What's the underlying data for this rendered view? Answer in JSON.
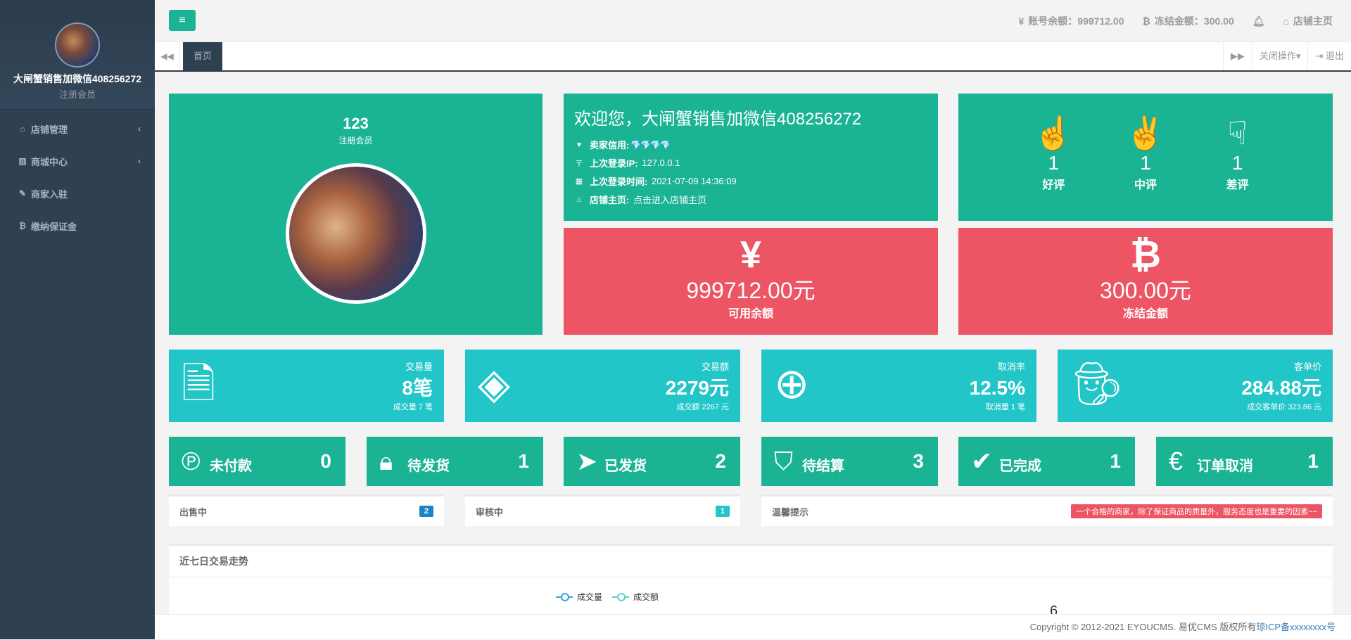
{
  "sidebar": {
    "username": "大闸蟹销售加微信408256272",
    "role": "注册会员",
    "items": [
      {
        "label": "店铺管理",
        "icon": "home-icon"
      },
      {
        "label": "商城中心",
        "icon": "bar-chart-icon"
      },
      {
        "label": "商家入驻",
        "icon": "edit-icon"
      },
      {
        "label": "缴纳保证金",
        "icon": "bitcoin-icon"
      }
    ]
  },
  "topbar": {
    "balance_label": "账号余额：",
    "balance_value": "999712.00",
    "frozen_label": "冻结金额：",
    "frozen_value": "300.00",
    "shop_home": "店铺主页"
  },
  "tabs": {
    "home": "首页",
    "close_ops": "关闭操作",
    "logout": "退出"
  },
  "profile": {
    "number": "123",
    "role": "注册会员"
  },
  "welcome": {
    "title": "欢迎您，大闸蟹销售加微信408256272",
    "credit_label": "卖家信用:",
    "credit_value": "💎💎💎💎",
    "ip_label": "上次登录IP:",
    "ip_value": "127.0.0.1",
    "time_label": "上次登录时间:",
    "time_value": "2021-07-09 14:36:09",
    "home_label": "店铺主页:",
    "home_value": "点击进入店铺主页"
  },
  "ratings": [
    {
      "count": "1",
      "label": "好评"
    },
    {
      "count": "1",
      "label": "中评"
    },
    {
      "count": "1",
      "label": "差评"
    }
  ],
  "money": {
    "available_symbol": "¥",
    "available_value": "999712.00元",
    "available_label": "可用余额",
    "frozen_symbol": "₿",
    "frozen_value": "300.00元",
    "frozen_label": "冻结金额"
  },
  "stats": [
    {
      "caption": "交易量",
      "value": "8笔",
      "foot": "成交量 7 笔"
    },
    {
      "caption": "交易额",
      "value": "2279元",
      "foot": "成交额 2267 元"
    },
    {
      "caption": "取消率",
      "value": "12.5%",
      "foot": "取消量 1 笔"
    },
    {
      "caption": "客单价",
      "value": "284.88元",
      "foot": "成交客单价 323.86 元"
    }
  ],
  "orders": [
    {
      "label": "未付款",
      "count": "0"
    },
    {
      "label": "待发货",
      "count": "1"
    },
    {
      "label": "已发货",
      "count": "2"
    },
    {
      "label": "待结算",
      "count": "3"
    },
    {
      "label": "已完成",
      "count": "1"
    },
    {
      "label": "订单取消",
      "count": "1"
    }
  ],
  "info": {
    "selling_label": "出售中",
    "selling_count": "2",
    "review_label": "审核中",
    "review_count": "1",
    "tip_label": "温馨提示",
    "tip_text": "一个合格的商家，除了保证商品的质量外，服务态度也是重要的因素~~"
  },
  "trend": {
    "title": "近七日交易走势",
    "legend_volume": "成交量",
    "legend_amount": "成交额",
    "tick": "6"
  },
  "footer": {
    "copyright": "Copyright © 2012-2021 EYOUCMS. 易优CMS 版权所有",
    "icp": "琼ICP备xxxxxxxx号"
  },
  "colors": {
    "green": "#1ab394",
    "red": "#ed5565",
    "cyan": "#23c6c8",
    "navy": "#2f4050"
  }
}
